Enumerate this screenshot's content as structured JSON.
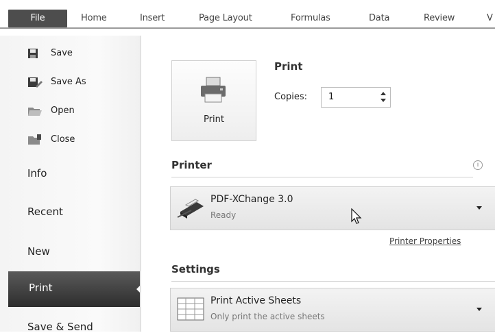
{
  "ribbon": {
    "tabs": [
      "File",
      "Home",
      "Insert",
      "Page Layout",
      "Formulas",
      "Data",
      "Review",
      "V"
    ]
  },
  "nav": {
    "commands": [
      {
        "label": "Save",
        "icon": "save-icon"
      },
      {
        "label": "Save As",
        "icon": "save-as-icon"
      },
      {
        "label": "Open",
        "icon": "open-folder-icon"
      },
      {
        "label": "Close",
        "icon": "close-folder-icon"
      }
    ],
    "sections": [
      "Info",
      "Recent",
      "New",
      "Print",
      "Save & Send"
    ],
    "selected": "Print"
  },
  "print": {
    "heading": "Print",
    "button_label": "Print",
    "copies_label": "Copies:",
    "copies_value": "1"
  },
  "printer": {
    "heading": "Printer",
    "name": "PDF-XChange 3.0",
    "status": "Ready",
    "properties_link": "Printer Properties",
    "info_glyph": "i"
  },
  "settings": {
    "heading": "Settings",
    "option_title": "Print Active Sheets",
    "option_sub": "Only print the active sheets"
  },
  "colors": {
    "file_tab": "#4d4d4d",
    "selected_nav": "#3a3a3a",
    "dropdown_bg": "#e8e8e8"
  }
}
